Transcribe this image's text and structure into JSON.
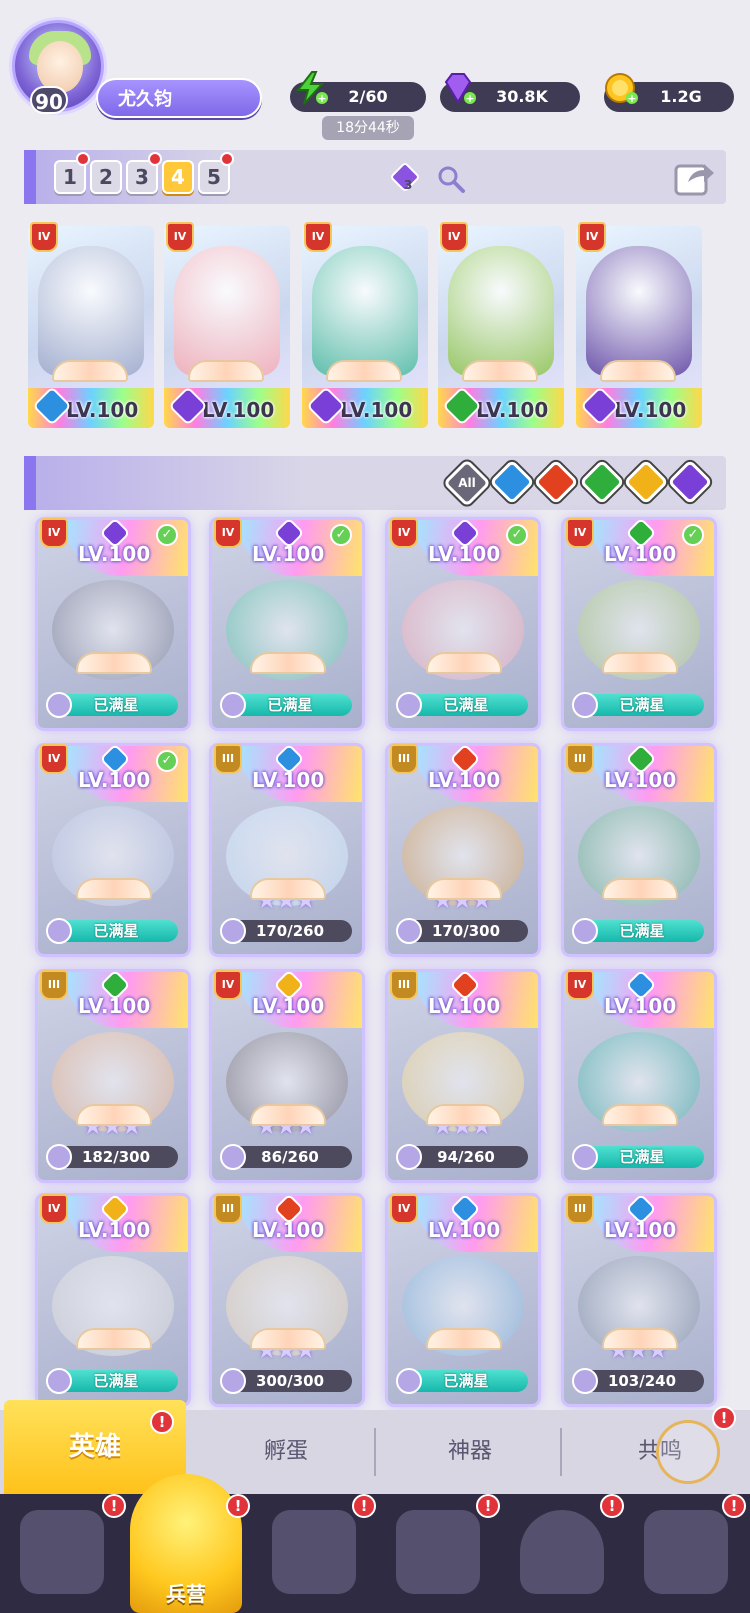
{
  "player": {
    "level": "90",
    "name": "尤久钧"
  },
  "resources": {
    "energy": "2/60",
    "energy_timer": "18分44秒",
    "gems": "30.8K",
    "gold": "1.2G"
  },
  "team_slots": [
    {
      "label": "1",
      "alert": true,
      "active": false
    },
    {
      "label": "2",
      "alert": false,
      "active": false
    },
    {
      "label": "3",
      "alert": true,
      "active": false
    },
    {
      "label": "4",
      "alert": false,
      "active": true
    },
    {
      "label": "5",
      "alert": true,
      "active": false
    }
  ],
  "team_badge_count": "3",
  "featured_heroes": [
    {
      "tier": "IV",
      "element": "water",
      "level": "LV.100"
    },
    {
      "tier": "IV",
      "element": "dark",
      "level": "LV.100"
    },
    {
      "tier": "IV",
      "element": "dark",
      "level": "LV.100"
    },
    {
      "tier": "IV",
      "element": "nature",
      "level": "LV.100"
    },
    {
      "tier": "IV",
      "element": "dark",
      "level": "LV.100"
    }
  ],
  "filters": {
    "all_label": "All",
    "elements": [
      "water",
      "fire",
      "nature",
      "light",
      "dark"
    ]
  },
  "heroes": [
    {
      "tier": "IV",
      "element": "dark",
      "level": "LV.100",
      "status": "已满星",
      "full": true,
      "check": true
    },
    {
      "tier": "IV",
      "element": "dark",
      "level": "LV.100",
      "status": "已满星",
      "full": true,
      "check": true
    },
    {
      "tier": "IV",
      "element": "dark",
      "level": "LV.100",
      "status": "已满星",
      "full": true,
      "check": true
    },
    {
      "tier": "IV",
      "element": "nature",
      "level": "LV.100",
      "status": "已满星",
      "full": true,
      "check": true
    },
    {
      "tier": "IV",
      "element": "water",
      "level": "LV.100",
      "status": "已满星",
      "full": true,
      "check": true
    },
    {
      "tier": "III",
      "element": "water",
      "level": "LV.100",
      "status": "170/260",
      "full": false,
      "check": false
    },
    {
      "tier": "III",
      "element": "fire",
      "level": "LV.100",
      "status": "170/300",
      "full": false,
      "check": false
    },
    {
      "tier": "III",
      "element": "nature",
      "level": "LV.100",
      "status": "已满星",
      "full": true,
      "check": false
    },
    {
      "tier": "III",
      "element": "nature",
      "level": "LV.100",
      "status": "182/300",
      "full": false,
      "check": false
    },
    {
      "tier": "IV",
      "element": "light",
      "level": "LV.100",
      "status": "86/260",
      "full": false,
      "check": false
    },
    {
      "tier": "III",
      "element": "fire",
      "level": "LV.100",
      "status": "94/260",
      "full": false,
      "check": false
    },
    {
      "tier": "IV",
      "element": "water",
      "level": "LV.100",
      "status": "已满星",
      "full": true,
      "check": false
    },
    {
      "tier": "IV",
      "element": "light",
      "level": "LV.100",
      "status": "已满星",
      "full": true,
      "check": false
    },
    {
      "tier": "III",
      "element": "fire",
      "level": "LV.100",
      "status": "300/300",
      "full": false,
      "check": false
    },
    {
      "tier": "IV",
      "element": "water",
      "level": "LV.100",
      "status": "已满星",
      "full": true,
      "check": false
    },
    {
      "tier": "III",
      "element": "water",
      "level": "LV.100",
      "status": "103/240",
      "full": false,
      "check": false
    }
  ],
  "tabs": [
    "英雄",
    "孵蛋",
    "神器",
    "共鸣"
  ],
  "bottom_nav": {
    "active_label": "兵营"
  },
  "element_colors": {
    "water": "#2c8fe0",
    "fire": "#e2411f",
    "nature": "#2fae3b",
    "light": "#f0b218",
    "dark": "#7a3fd6"
  }
}
